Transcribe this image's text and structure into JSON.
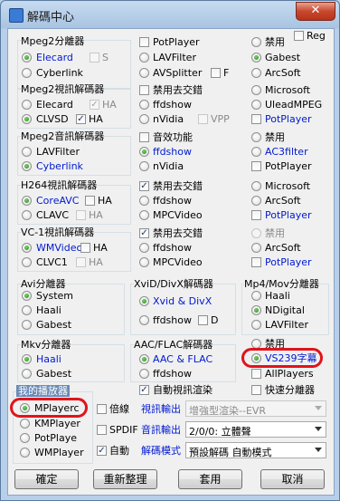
{
  "window": {
    "title": "解碼中心",
    "close_glyph": "✕"
  },
  "reg": "Reg",
  "mpeg2_splitter": {
    "title": "Mpeg2分離器",
    "elecard": "Elecard",
    "s": "S",
    "cyberlink": "Cyberlink"
  },
  "splitter_col2": {
    "potplayer": "PotPlayer",
    "lavfilter": "LAVFilter",
    "avsplitter": "AVSplitter",
    "f": "F"
  },
  "splitter_col3": {
    "disable": "禁用",
    "gabest": "Gabest",
    "arcsoft": "ArcSoft"
  },
  "mpeg2_video": {
    "title": "Mpeg2視訊解碼器",
    "elecard": "Elecard",
    "ha1": "HA",
    "clvsd": "CLVSD",
    "ha2": "HA"
  },
  "mpeg2_video_col2": {
    "deint": "禁用去交錯",
    "ffdshow": "ffdshow",
    "nvidia": "nVidia",
    "vpp": "VPP"
  },
  "mpeg2_video_col3": {
    "microsoft": "Microsoft",
    "uleadmpeg": "UleadMPEG",
    "potplayer": "PotPlayer"
  },
  "mpeg2_audio": {
    "title": "Mpeg2音訊解碼器",
    "lavfilter": "LAVFilter",
    "cyberlink": "Cyberlink"
  },
  "mpeg2_audio_col2": {
    "sound": "音效功能",
    "ffdshow": "ffdshow",
    "nvidia": "nVidia"
  },
  "mpeg2_audio_col3": {
    "disable": "禁用",
    "ac3filter": "AC3filter",
    "potplayer": "PotPlayer"
  },
  "h264": {
    "title": "H264視訊解碼器",
    "coreavc": "CoreAVC",
    "ha1": "HA",
    "clavc": "CLAVC",
    "ha2": "HA"
  },
  "h264_col2": {
    "deint": "禁用去交錯",
    "ffdshow": "ffdshow",
    "mpcvideo": "MPCVideo"
  },
  "h264_col3": {
    "microsoft": "Microsoft",
    "arcsoft": "ArcSoft",
    "potplayer": "PotPlayer"
  },
  "vc1": {
    "title": "VC-1視訊解碼器",
    "wmvideo": "WMVideo",
    "ha1": "HA",
    "clvc1": "CLVC1",
    "ha2": "HA"
  },
  "vc1_col2": {
    "deint": "禁用去交錯",
    "ffdshow": "ffdshow",
    "mpcvideo": "MPCVideo"
  },
  "vc1_col3": {
    "disable": "禁用",
    "arcsoft": "ArcSoft",
    "potplayer": "PotPlayer"
  },
  "avi": {
    "title": "Avi分離器",
    "system": "System",
    "haali": "Haali",
    "gabest": "Gabest"
  },
  "xvid": {
    "title": "XviD/DivX解碼器",
    "xvid_divx": "Xvid & DivX",
    "ffdshow": "ffdshow",
    "d": "D"
  },
  "mp4": {
    "title": "Mp4/Mov分離器",
    "haali": "Haali",
    "ndigital": "NDigital",
    "lavfilter": "LAVFilter"
  },
  "mkv": {
    "title": "Mkv分離器",
    "haali": "Haali",
    "gabest": "Gabest"
  },
  "aac": {
    "title": "AAC/FLAC解碼器",
    "aac_flac": "AAC & FLAC",
    "ffdshow": "ffdshow"
  },
  "col3b": {
    "disable": "禁用",
    "vs239": "VS239字幕",
    "allplayers": "AllPlayers"
  },
  "options": {
    "auto_render": "自動視訊渲染",
    "quick_split": "快速分離器",
    "multiplier": "倍線",
    "video_out_label": "視訊輸出",
    "video_out_value": "增強型渲染--EVR",
    "spdif": "SPDIF",
    "audio_out_label": "音訊輸出",
    "audio_out_value": "2/0/0: 立體聲",
    "auto": "自動",
    "decode_mode_label": "解碼模式",
    "decode_mode_value": "預設解碼 自動模式"
  },
  "player": {
    "title": "我的播放器",
    "mplayerc": "MPlayerc",
    "kmplayer": "KMPlayer",
    "potplayer": "PotPlaye",
    "wmplayer": "WMPlayer"
  },
  "buttons": {
    "ok": "確定",
    "reorganize": "重新整理",
    "apply": "套用",
    "cancel": "取消"
  },
  "colors": {
    "selected_text": "#0019d0",
    "highlight_ring": "#e0141a"
  }
}
